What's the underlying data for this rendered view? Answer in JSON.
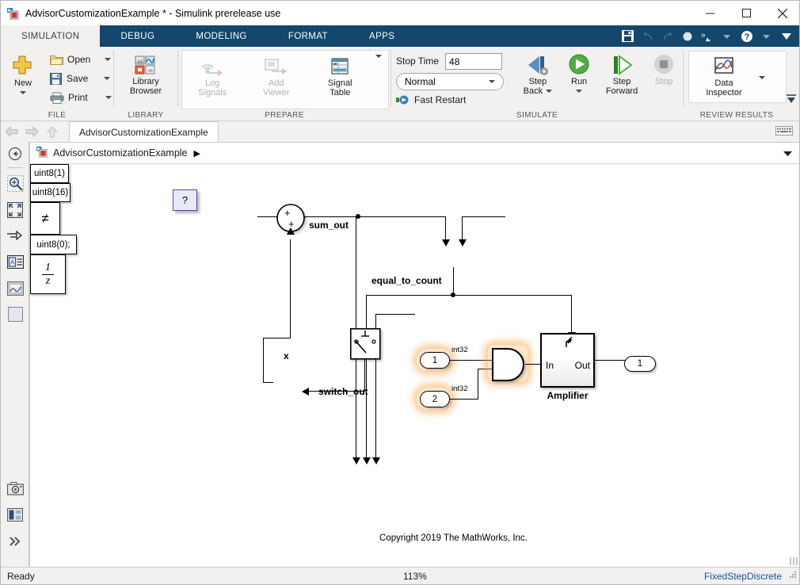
{
  "window": {
    "title": "AdvisorCustomizationExample * - Simulink prerelease use",
    "icon": "simulink-model-icon",
    "minimize": "minimize-button",
    "maximize": "maximize-button",
    "close": "close-button"
  },
  "ribbon_tabs": [
    {
      "label": "SIMULATION",
      "active": true
    },
    {
      "label": "DEBUG",
      "active": false
    },
    {
      "label": "MODELING",
      "active": false
    },
    {
      "label": "FORMAT",
      "active": false
    },
    {
      "label": "APPS",
      "active": false
    }
  ],
  "quick_access": [
    {
      "name": "save-icon"
    },
    {
      "name": "undo-icon"
    },
    {
      "name": "redo-icon"
    },
    {
      "name": "circle-icon"
    },
    {
      "name": "shortcuts-icon"
    },
    {
      "name": "shortcuts-dropdown-icon"
    },
    {
      "name": "help-icon"
    },
    {
      "name": "help-dropdown-icon"
    },
    {
      "name": "collapse-ribbon-icon"
    }
  ],
  "ribbon": {
    "file": {
      "group_label": "FILE",
      "new_label": "New",
      "open_label": "Open",
      "save_label": "Save",
      "print_label": "Print"
    },
    "library": {
      "group_label": "LIBRARY",
      "library_browser_line1": "Library",
      "library_browser_line2": "Browser"
    },
    "prepare": {
      "group_label": "PREPARE",
      "log_signals_line1": "Log",
      "log_signals_line2": "Signals",
      "add_viewer_line1": "Add",
      "add_viewer_line2": "Viewer",
      "signal_table_line1": "Signal",
      "signal_table_line2": "Table"
    },
    "simulate": {
      "group_label": "SIMULATE",
      "stop_time_label": "Stop Time",
      "stop_time_value": "48",
      "mode_value": "Normal",
      "fast_restart_label": "Fast Restart",
      "step_back_line1": "Step",
      "step_back_line2": "Back",
      "run_label": "Run",
      "step_forward_line1": "Step",
      "step_forward_line2": "Forward",
      "stop_label": "Stop"
    },
    "review": {
      "group_label": "REVIEW RESULTS",
      "data_inspector_line1": "Data",
      "data_inspector_line2": "Inspector"
    }
  },
  "nav": {
    "back": "back-arrow",
    "forward": "forward-arrow",
    "up": "up-arrow",
    "doc_tab": "AdvisorCustomizationExample",
    "keyboard_icon": "keyboard-icon"
  },
  "breadcrumb": {
    "back_icon": "navigate-back-icon",
    "model_icon": "model-icon",
    "label": "AdvisorCustomizationExample",
    "separator": "▶",
    "expand_icon": "chevron-down-icon"
  },
  "rail_tools": [
    {
      "name": "rail-zoom-tool"
    },
    {
      "name": "rail-fit-to-view-tool"
    },
    {
      "name": "rail-signal-tool"
    },
    {
      "name": "rail-annotation-tool"
    },
    {
      "name": "rail-image-tool"
    },
    {
      "name": "rail-area-tool"
    },
    {
      "name": "rail-camera-tool"
    },
    {
      "name": "rail-layout-tool"
    },
    {
      "name": "rail-more-tool"
    }
  ],
  "canvas": {
    "copyright": "Copyright 2019 The MathWorks, Inc.",
    "annotation_note": "?",
    "blocks": [
      {
        "name": "constant-uint8-1",
        "label": "uint8(1)"
      },
      {
        "name": "sum-block",
        "label": "+"
      },
      {
        "name": "constant-uint8-16",
        "label": "uint8(16)"
      },
      {
        "name": "relational-operator-block",
        "label": "≠"
      },
      {
        "name": "constant-uint8-0",
        "label": "uint8(0);"
      },
      {
        "name": "multiport-switch-block",
        "label": ""
      },
      {
        "name": "unit-delay-block",
        "numerator": "1",
        "denominator": "z"
      },
      {
        "name": "logical-and-block",
        "label": ""
      },
      {
        "name": "amplifier-subsystem",
        "label": "Amplifier",
        "in_port": "In",
        "out_port": "Out"
      },
      {
        "name": "inport-1",
        "label": "1"
      },
      {
        "name": "inport-2",
        "label": "2"
      },
      {
        "name": "outport-1",
        "label": "1"
      }
    ],
    "signal_labels": [
      {
        "name": "signal-label-sum-out",
        "text": "sum_out"
      },
      {
        "name": "signal-label-equal-to-count",
        "text": "equal_to_count"
      },
      {
        "name": "signal-label-switch-out",
        "text": "switch_out"
      },
      {
        "name": "signal-label-x",
        "text": "x"
      }
    ],
    "type_labels": [
      {
        "name": "type-label-inport-1",
        "text": "int32"
      },
      {
        "name": "type-label-inport-2",
        "text": "int32"
      }
    ]
  },
  "status": {
    "state": "Ready",
    "zoom": "113%",
    "solver": "FixedStepDiscrete"
  },
  "colors": {
    "ribbon_tab_bar": "#13476b",
    "ribbon_body": "#f2f1f0",
    "accent_link": "#1553a0",
    "note_border": "#4a4ab8",
    "highlight_glow": "#f6a03c"
  }
}
